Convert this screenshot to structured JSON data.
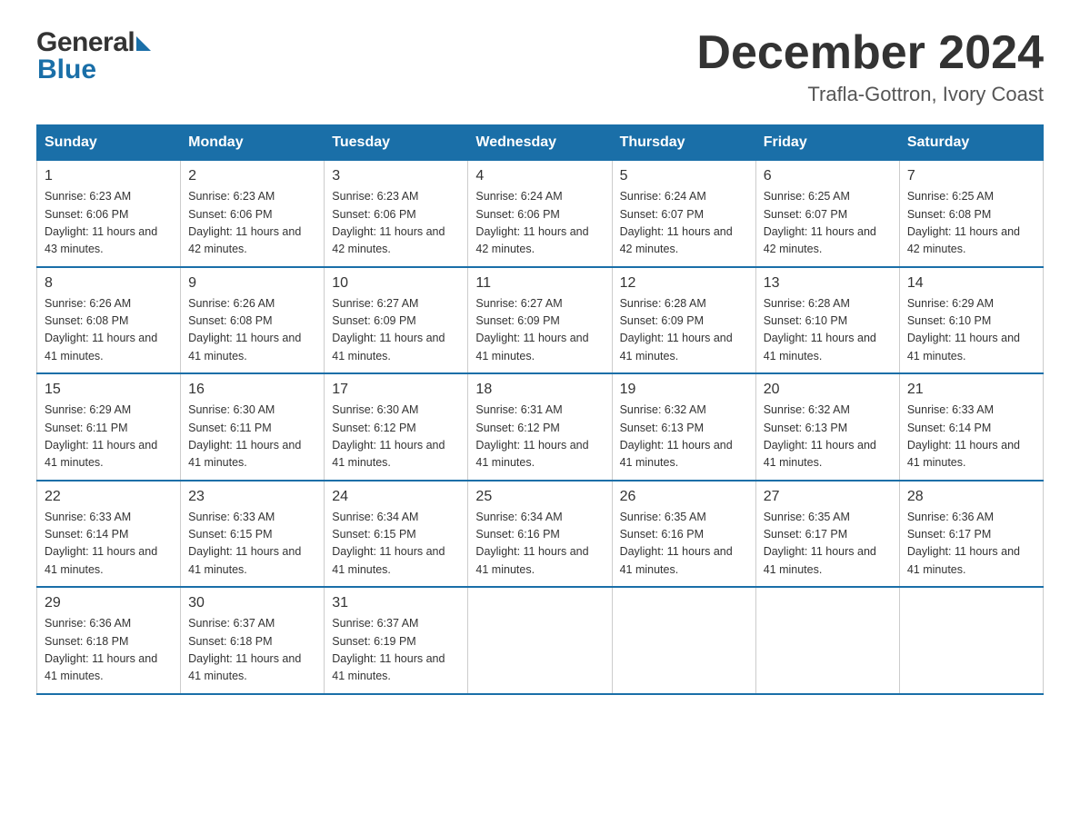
{
  "header": {
    "logo_general": "General",
    "logo_blue": "Blue",
    "month_title": "December 2024",
    "subtitle": "Trafla-Gottron, Ivory Coast"
  },
  "calendar": {
    "days_of_week": [
      "Sunday",
      "Monday",
      "Tuesday",
      "Wednesday",
      "Thursday",
      "Friday",
      "Saturday"
    ],
    "weeks": [
      [
        {
          "day": "1",
          "sunrise": "6:23 AM",
          "sunset": "6:06 PM",
          "daylight": "11 hours and 43 minutes."
        },
        {
          "day": "2",
          "sunrise": "6:23 AM",
          "sunset": "6:06 PM",
          "daylight": "11 hours and 42 minutes."
        },
        {
          "day": "3",
          "sunrise": "6:23 AM",
          "sunset": "6:06 PM",
          "daylight": "11 hours and 42 minutes."
        },
        {
          "day": "4",
          "sunrise": "6:24 AM",
          "sunset": "6:06 PM",
          "daylight": "11 hours and 42 minutes."
        },
        {
          "day": "5",
          "sunrise": "6:24 AM",
          "sunset": "6:07 PM",
          "daylight": "11 hours and 42 minutes."
        },
        {
          "day": "6",
          "sunrise": "6:25 AM",
          "sunset": "6:07 PM",
          "daylight": "11 hours and 42 minutes."
        },
        {
          "day": "7",
          "sunrise": "6:25 AM",
          "sunset": "6:08 PM",
          "daylight": "11 hours and 42 minutes."
        }
      ],
      [
        {
          "day": "8",
          "sunrise": "6:26 AM",
          "sunset": "6:08 PM",
          "daylight": "11 hours and 41 minutes."
        },
        {
          "day": "9",
          "sunrise": "6:26 AM",
          "sunset": "6:08 PM",
          "daylight": "11 hours and 41 minutes."
        },
        {
          "day": "10",
          "sunrise": "6:27 AM",
          "sunset": "6:09 PM",
          "daylight": "11 hours and 41 minutes."
        },
        {
          "day": "11",
          "sunrise": "6:27 AM",
          "sunset": "6:09 PM",
          "daylight": "11 hours and 41 minutes."
        },
        {
          "day": "12",
          "sunrise": "6:28 AM",
          "sunset": "6:09 PM",
          "daylight": "11 hours and 41 minutes."
        },
        {
          "day": "13",
          "sunrise": "6:28 AM",
          "sunset": "6:10 PM",
          "daylight": "11 hours and 41 minutes."
        },
        {
          "day": "14",
          "sunrise": "6:29 AM",
          "sunset": "6:10 PM",
          "daylight": "11 hours and 41 minutes."
        }
      ],
      [
        {
          "day": "15",
          "sunrise": "6:29 AM",
          "sunset": "6:11 PM",
          "daylight": "11 hours and 41 minutes."
        },
        {
          "day": "16",
          "sunrise": "6:30 AM",
          "sunset": "6:11 PM",
          "daylight": "11 hours and 41 minutes."
        },
        {
          "day": "17",
          "sunrise": "6:30 AM",
          "sunset": "6:12 PM",
          "daylight": "11 hours and 41 minutes."
        },
        {
          "day": "18",
          "sunrise": "6:31 AM",
          "sunset": "6:12 PM",
          "daylight": "11 hours and 41 minutes."
        },
        {
          "day": "19",
          "sunrise": "6:32 AM",
          "sunset": "6:13 PM",
          "daylight": "11 hours and 41 minutes."
        },
        {
          "day": "20",
          "sunrise": "6:32 AM",
          "sunset": "6:13 PM",
          "daylight": "11 hours and 41 minutes."
        },
        {
          "day": "21",
          "sunrise": "6:33 AM",
          "sunset": "6:14 PM",
          "daylight": "11 hours and 41 minutes."
        }
      ],
      [
        {
          "day": "22",
          "sunrise": "6:33 AM",
          "sunset": "6:14 PM",
          "daylight": "11 hours and 41 minutes."
        },
        {
          "day": "23",
          "sunrise": "6:33 AM",
          "sunset": "6:15 PM",
          "daylight": "11 hours and 41 minutes."
        },
        {
          "day": "24",
          "sunrise": "6:34 AM",
          "sunset": "6:15 PM",
          "daylight": "11 hours and 41 minutes."
        },
        {
          "day": "25",
          "sunrise": "6:34 AM",
          "sunset": "6:16 PM",
          "daylight": "11 hours and 41 minutes."
        },
        {
          "day": "26",
          "sunrise": "6:35 AM",
          "sunset": "6:16 PM",
          "daylight": "11 hours and 41 minutes."
        },
        {
          "day": "27",
          "sunrise": "6:35 AM",
          "sunset": "6:17 PM",
          "daylight": "11 hours and 41 minutes."
        },
        {
          "day": "28",
          "sunrise": "6:36 AM",
          "sunset": "6:17 PM",
          "daylight": "11 hours and 41 minutes."
        }
      ],
      [
        {
          "day": "29",
          "sunrise": "6:36 AM",
          "sunset": "6:18 PM",
          "daylight": "11 hours and 41 minutes."
        },
        {
          "day": "30",
          "sunrise": "6:37 AM",
          "sunset": "6:18 PM",
          "daylight": "11 hours and 41 minutes."
        },
        {
          "day": "31",
          "sunrise": "6:37 AM",
          "sunset": "6:19 PM",
          "daylight": "11 hours and 41 minutes."
        },
        null,
        null,
        null,
        null
      ]
    ]
  }
}
